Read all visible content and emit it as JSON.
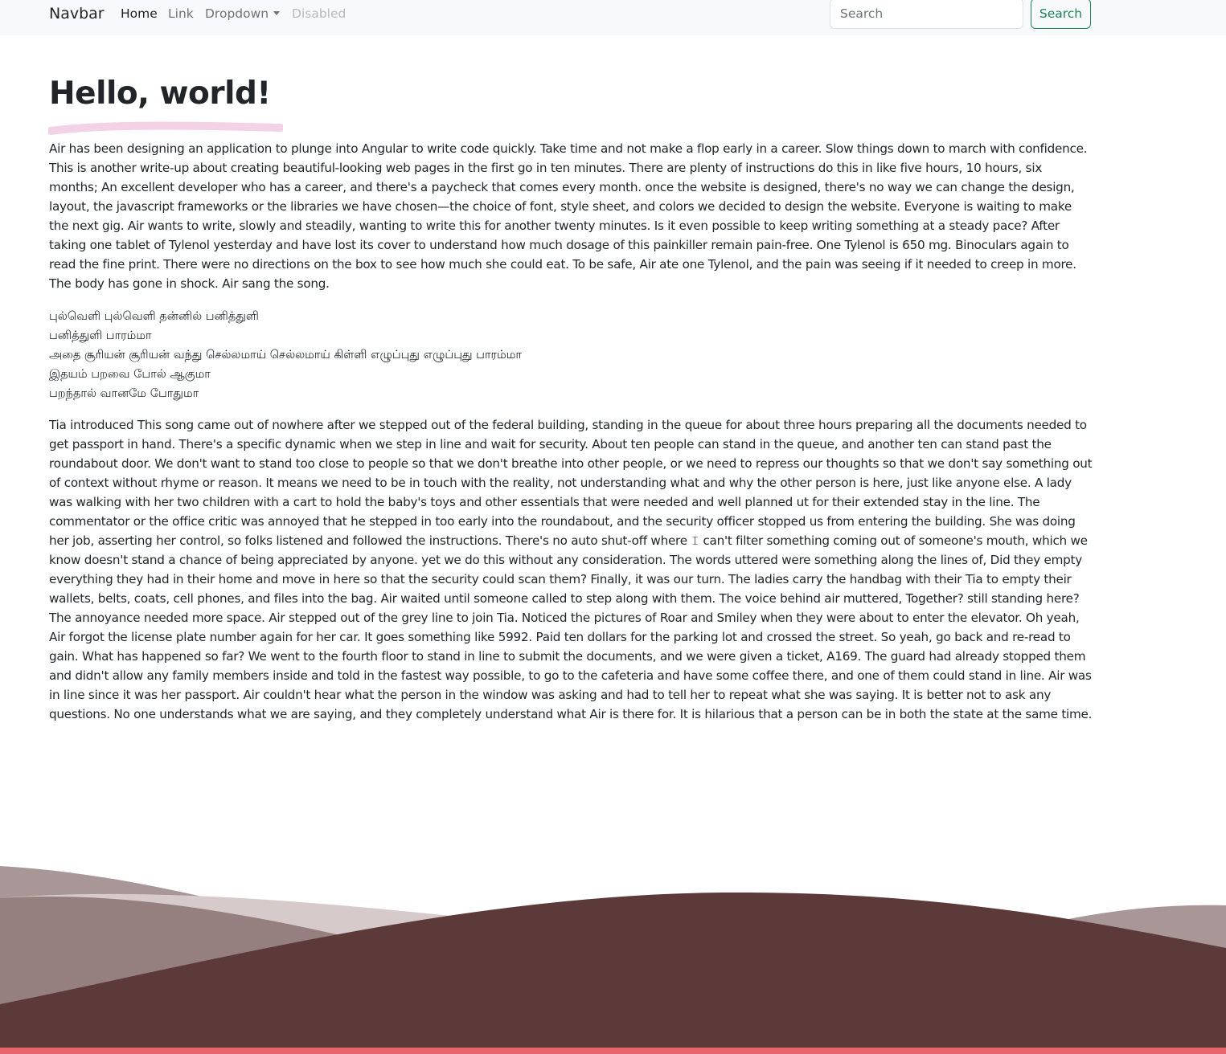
{
  "navbar": {
    "brand": "Navbar",
    "links": [
      {
        "label": "Home",
        "state": "active"
      },
      {
        "label": "Link",
        "state": "normal"
      },
      {
        "label": "Dropdown",
        "state": "dropdown"
      },
      {
        "label": "Disabled",
        "state": "disabled"
      }
    ],
    "search": {
      "placeholder": "Search",
      "button_label": "Search"
    }
  },
  "main": {
    "title": "Hello, world!",
    "paragraph_1": "Air has been designing an application to plunge into Angular to write code quickly. Take time and not make a flop early in a career. Slow things down to march with confidence. This is another write-up about creating beautiful-looking web pages in the first go in ten minutes. There are plenty of instructions do this in like five hours, 10 hours, six months; An excellent developer who has a career, and there's a paycheck that comes every month. once the website is designed, there's no way we can change the design, layout, the javascript frameworks or the libraries we have chosen—the choice of font, style sheet, and colors we decided to design the website. Everyone is waiting to make the next gig. Air wants to write, slowly and steadily, wanting to write this for another twenty minutes. Is it even possible to keep writing something at a steady pace? After taking one tablet of Tylenol yesterday and have lost its cover to understand how much dosage of this painkiller remain pain-free. One Tylenol is 650 mg. Binoculars again to read the fine print. There were no directions on the box to see how much she could eat. To be safe, Air ate one Tylenol, and the pain was seeing if it needed to creep in more. The body has gone in shock. Air sang the song.",
    "song_lines": [
      "புல்வெளி புல்வெளி தன்னில் பனித்துளி",
      "பனித்துளி பாரம்மா",
      "அதை சூரியன் சூரியன் வந்து செல்லமாய் செல்லமாய் கிள்ளி எழுப்புது எழுப்புது பாரம்மா",
      "இதயம் பறவை போல் ஆகுமா",
      "பறந்தால் வானமே போதுமா"
    ],
    "paragraph_2": "Tia introduced This song came out of nowhere after we stepped out of the federal building, standing in the queue for about three hours preparing all the documents needed to get passport in hand. There's a specific dynamic when we step in line and wait for security. About ten people can stand in the queue, and another ten can stand past the roundabout door. We don't want to stand too close to people so that we don't breathe into other people, or we need to repress our thoughts so that we don't say something out of context without rhyme or reason. It means we need to be in touch with the reality, not understanding what and why the other person is here, just like anyone else. A lady was walking with her two children with a cart to hold the baby's toys and other essentials that were needed and well planned ut for their extended stay in the line. The commentator or the office critic was annoyed that he stepped in too early into the roundabout, and the security officer stopped us from entering the building. She was doing her job, asserting her control, so folks listened and followed the instructions. There's no auto shut-off where 𝙸 can't filter something coming out of someone's mouth, which we know doesn't stand a chance of being appreciated by anyone. yet we do this without any consideration. The words uttered were something along the lines of, Did they empty everything they had in their home and move in here so that the security could scan them? Finally, it was our turn. The ladies carry the handbag with their Tia to empty their wallets, belts, coats, cell phones, and files into the bag. Air waited until someone called to step along with them. The voice behind air muttered, Together? still standing here? The annoyance needed more space. Air stepped out of the grey line to join Tia. Noticed the pictures of Roar and Smiley when they were about to enter the elevator. Oh yeah, Air forgot the license plate number again for her car. It goes something like 5992. Paid ten dollars for the parking lot and crossed the street. So yeah, go back and re-read to gain. What has happened so far? We went to the fourth floor to stand in line to submit the documents, and we were given a ticket, A169. The guard had already stopped them and didn't allow any family members inside and told in the fastest way possible, to go to the cafeteria and have some coffee there, and one of them could stand in line. Air was in line since it was her passport. Air couldn't hear what the person in the window was asking and had to tell her to repeat what she was saying. It is better not to ask any questions. No one understands what we are saying, and they completely understand what Air is there for. It is hilarious that a person can be in both the state at the same time."
  },
  "colors": {
    "navbar_bg": "#f8f9fa",
    "search_accent": "#198754",
    "title_underline": "#f3d2e8",
    "wave_back": "#a99797",
    "wave_light": "#d6cbca",
    "wave_mid": "#957f7f",
    "wave_front": "#5c3a3a",
    "footer_accent": "#e8636b"
  },
  "icons": {
    "dropdown": "caret-down-icon"
  }
}
